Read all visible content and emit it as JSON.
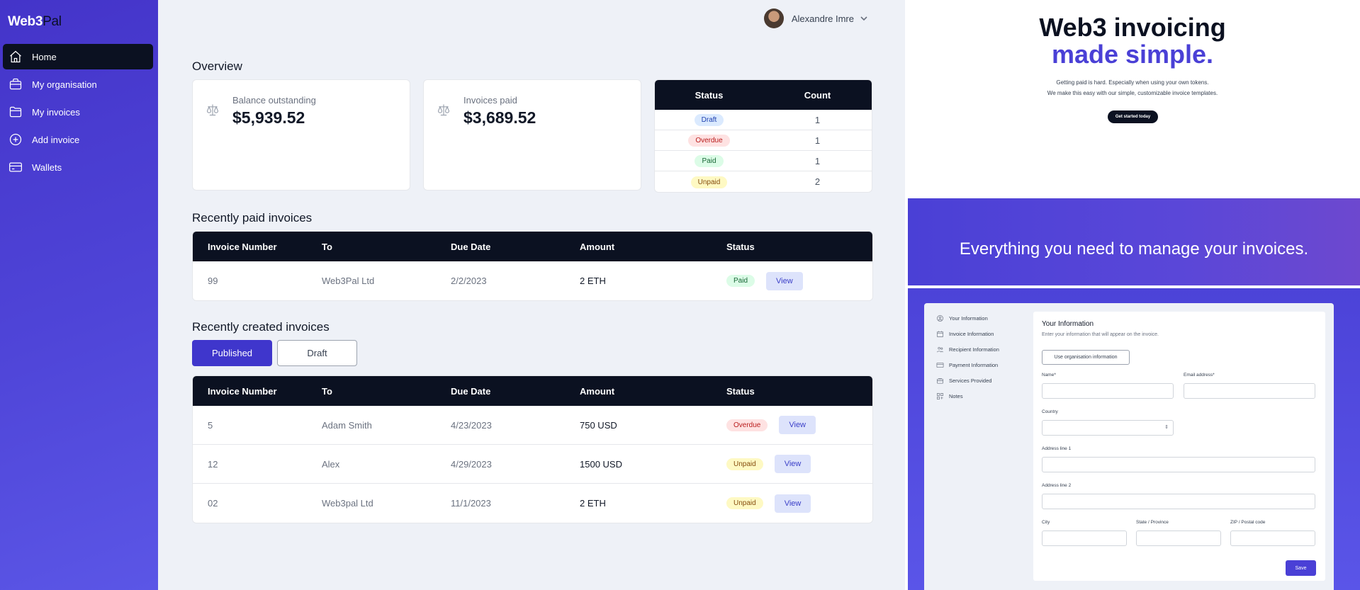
{
  "brand": {
    "web3": "Web3",
    "pal": "Pal"
  },
  "sidebar": {
    "items": [
      {
        "label": "Home",
        "icon": "home-icon",
        "active": true
      },
      {
        "label": "My organisation",
        "icon": "briefcase-icon"
      },
      {
        "label": "My invoices",
        "icon": "folder-icon"
      },
      {
        "label": "Add invoice",
        "icon": "plus-circle-icon"
      },
      {
        "label": "Wallets",
        "icon": "credit-card-icon"
      }
    ]
  },
  "user": {
    "name": "Alexandre Imre"
  },
  "overview": {
    "title": "Overview",
    "balance": {
      "label": "Balance outstanding",
      "value": "$5,939.52"
    },
    "paid": {
      "label": "Invoices paid",
      "value": "$3,689.52"
    },
    "status_table": {
      "headers": [
        "Status",
        "Count"
      ],
      "rows": [
        {
          "status": "Draft",
          "count": "1"
        },
        {
          "status": "Overdue",
          "count": "1"
        },
        {
          "status": "Paid",
          "count": "1"
        },
        {
          "status": "Unpaid",
          "count": "2"
        }
      ]
    }
  },
  "recently_paid": {
    "title": "Recently paid invoices",
    "headers": [
      "Invoice Number",
      "To",
      "Due Date",
      "Amount",
      "Status"
    ],
    "rows": [
      {
        "number": "99",
        "to": "Web3Pal Ltd",
        "due": "2/2/2023",
        "amount": "2 ETH",
        "status": "Paid",
        "action": "View"
      }
    ]
  },
  "recently_created": {
    "title": "Recently created invoices",
    "tabs": [
      "Published",
      "Draft"
    ],
    "headers": [
      "Invoice Number",
      "To",
      "Due Date",
      "Amount",
      "Status"
    ],
    "rows": [
      {
        "number": "5",
        "to": "Adam Smith",
        "due": "4/23/2023",
        "amount": "750 USD",
        "status": "Overdue",
        "action": "View"
      },
      {
        "number": "12",
        "to": "Alex",
        "due": "4/29/2023",
        "amount": "1500 USD",
        "status": "Unpaid",
        "action": "View"
      },
      {
        "number": "02",
        "to": "Web3pal Ltd",
        "due": "11/1/2023",
        "amount": "2 ETH",
        "status": "Unpaid",
        "action": "View"
      }
    ]
  },
  "preview": {
    "hero_line1": "Web3 invoicing",
    "hero_line2": "made simple.",
    "hero_sub1": "Getting paid is hard. Especially when using your own tokens.",
    "hero_sub2": "We make this easy with our simple, customizable invoice templates.",
    "hero_button": "Get started today",
    "band_text": "Everything you need to manage your invoices.",
    "app_nav": [
      "Your Information",
      "Invoice Information",
      "Recipient Information",
      "Payment Information",
      "Services Provided",
      "Notes"
    ],
    "form": {
      "title": "Your Information",
      "subtitle": "Enter your information that will appear on the invoice.",
      "org_button": "Use organisation information",
      "name_label": "Name*",
      "email_label": "Email address*",
      "country_label": "Country",
      "address1_label": "Address line 1",
      "address2_label": "Address line 2",
      "city_label": "City",
      "state_label": "State / Province",
      "zip_label": "ZIP / Postal code",
      "save_label": "Save"
    }
  }
}
